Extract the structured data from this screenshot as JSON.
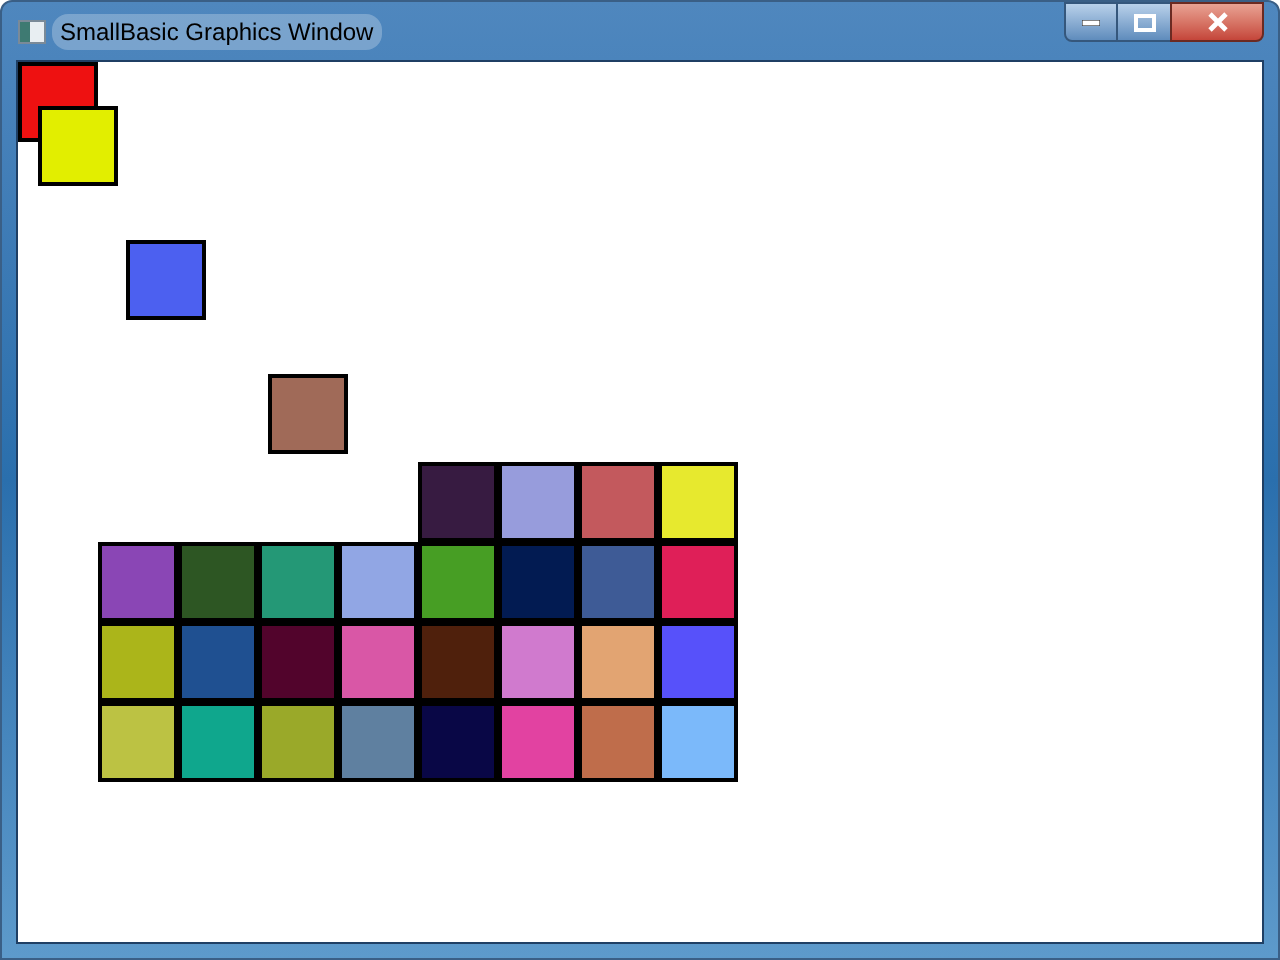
{
  "window": {
    "title": "SmallBasic Graphics Window"
  },
  "canvas": {
    "shapes": [
      {
        "color": "#ee1111"
      },
      {
        "color": "#e2ee00"
      },
      {
        "color": "#4c60f0"
      },
      {
        "color": "#a06a58"
      },
      {
        "color": "#371b41"
      },
      {
        "color": "#979cdc"
      },
      {
        "color": "#c3595d"
      },
      {
        "color": "#e7e92e"
      },
      {
        "color": "#8a46b5"
      },
      {
        "color": "#2d5623"
      },
      {
        "color": "#249876"
      },
      {
        "color": "#91a6e4"
      },
      {
        "color": "#479e24"
      },
      {
        "color": "#021b52"
      },
      {
        "color": "#3e5b96"
      },
      {
        "color": "#df1f58"
      },
      {
        "color": "#abb51a"
      },
      {
        "color": "#1f5091"
      },
      {
        "color": "#52042c"
      },
      {
        "color": "#d957a6"
      },
      {
        "color": "#4f200c"
      },
      {
        "color": "#d07ace"
      },
      {
        "color": "#e2a472"
      },
      {
        "color": "#5751fa"
      },
      {
        "color": "#bcc243"
      },
      {
        "color": "#0fa78d"
      },
      {
        "color": "#9aa929"
      },
      {
        "color": "#5f80a0"
      },
      {
        "color": "#090746"
      },
      {
        "color": "#e242a1"
      },
      {
        "color": "#bf6d4b"
      },
      {
        "color": "#7bb9fa"
      }
    ]
  }
}
